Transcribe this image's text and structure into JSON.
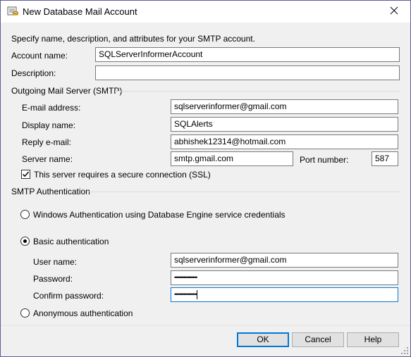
{
  "window": {
    "title": "New Database Mail Account",
    "close_icon": "close-icon",
    "app_icon": "database-mail-icon"
  },
  "intro": "Specify name, description, and attributes for your SMTP account.",
  "account": {
    "name_label": "Account name:",
    "name_value": "SQLServerInformerAccount",
    "description_label": "Description:",
    "description_value": ""
  },
  "smtp": {
    "group_label": "Outgoing Mail Server (SMTP)",
    "email_label": "E-mail address:",
    "email_value": "sqlserverinformer@gmail.com",
    "display_label": "Display name:",
    "display_value": "SQLAlerts",
    "reply_label": "Reply e-mail:",
    "reply_value": "abhishek12314@hotmail.com",
    "server_label": "Server name:",
    "server_value": "smtp.gmail.com",
    "port_label": "Port number:",
    "port_value": "587",
    "ssl_label": "This server requires a secure connection (SSL)",
    "ssl_checked": true
  },
  "auth": {
    "group_label": "SMTP Authentication",
    "windows_label": "Windows Authentication using Database Engine service credentials",
    "basic_label": "Basic authentication",
    "selected": "basic",
    "username_label": "User name:",
    "username_value": "sqlserverinformer@gmail.com",
    "password_label": "Password:",
    "password_value": "•••••••••••••••",
    "confirm_label": "Confirm password:",
    "confirm_value": "•••••••••••••••",
    "anonymous_label": "Anonymous authentication"
  },
  "buttons": {
    "ok": "OK",
    "cancel": "Cancel",
    "help": "Help"
  }
}
